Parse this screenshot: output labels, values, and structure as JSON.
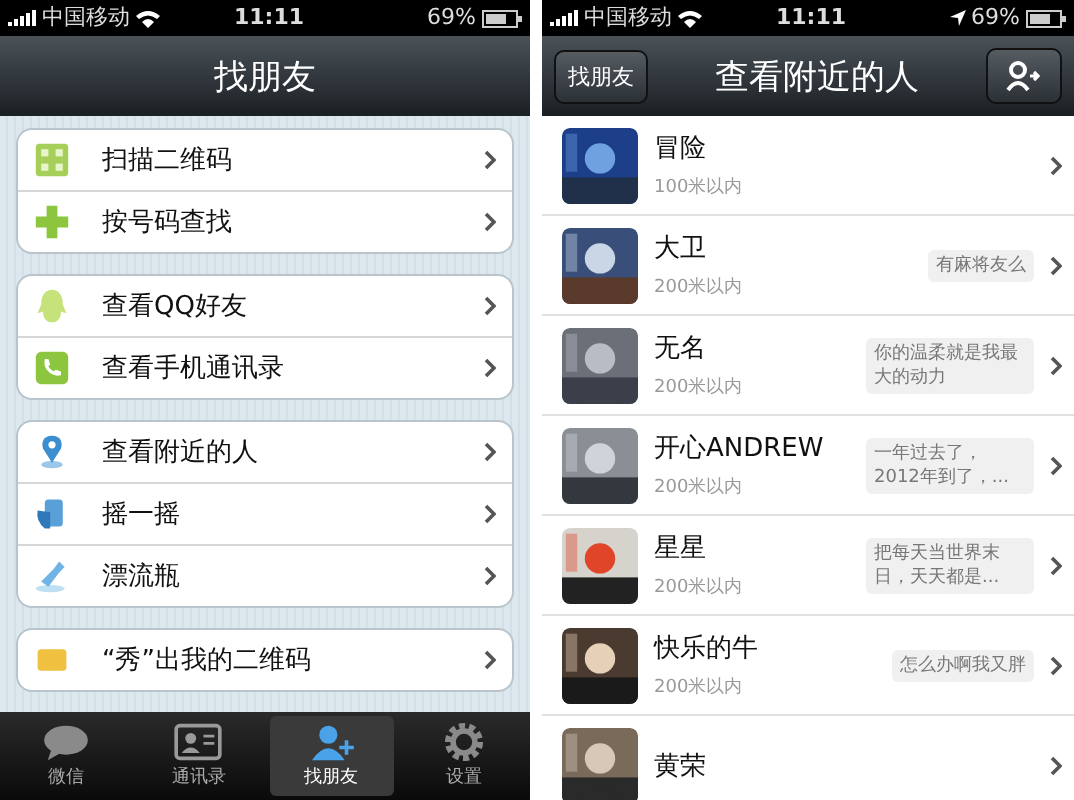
{
  "find_friends": {
    "status_bar": {
      "carrier": "中国移动",
      "time": "11:11",
      "battery": "69%",
      "location": false
    },
    "title": "找朋友",
    "groups": [
      [
        {
          "kind": "qr",
          "label": "扫描二维码"
        },
        {
          "kind": "plus",
          "label": "按号码查找"
        }
      ],
      [
        {
          "kind": "qq",
          "label": "查看QQ好友"
        },
        {
          "kind": "phone",
          "label": "查看手机通讯录"
        }
      ],
      [
        {
          "kind": "pin",
          "label": "查看附近的人"
        },
        {
          "kind": "shake",
          "label": "摇一摇"
        },
        {
          "kind": "bottle",
          "label": "漂流瓶"
        }
      ],
      [
        {
          "kind": "card",
          "label": "“秀”出我的二维码"
        }
      ]
    ],
    "tabs": [
      {
        "kind": "chat",
        "label": "微信",
        "selected": false
      },
      {
        "kind": "contacts",
        "label": "通讯录",
        "selected": false
      },
      {
        "kind": "find",
        "label": "找朋友",
        "selected": true
      },
      {
        "kind": "gear",
        "label": "设置",
        "selected": false
      }
    ]
  },
  "nearby": {
    "status_bar": {
      "carrier": "中国移动",
      "time": "11:11",
      "battery": "69%",
      "location": true
    },
    "back": "找朋友",
    "title": "查看附近的人",
    "people": [
      {
        "name": "冒险",
        "distance": "100米以内"
      },
      {
        "name": "大卫",
        "distance": "200米以内",
        "note": "有麻将友么"
      },
      {
        "name": "无名",
        "distance": "200米以内",
        "note": "你的温柔就是我最大的动力"
      },
      {
        "name": "开心ANDREW",
        "distance": "200米以内",
        "note": "一年过去了，2012年到了，..."
      },
      {
        "name": "星星",
        "distance": "200米以内",
        "note": "把每天当世界末日，天天都是..."
      },
      {
        "name": "快乐的牛",
        "distance": "200米以内",
        "note": "怎么办啊我又胖"
      },
      {
        "name": "黄荣"
      }
    ]
  }
}
